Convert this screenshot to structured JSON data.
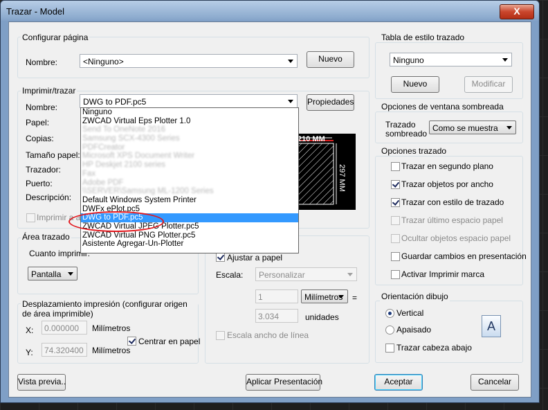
{
  "window": {
    "title": "Trazar - Model",
    "close_glyph": "X"
  },
  "configurar": {
    "group_label": "Configurar página",
    "nombre_label": "Nombre:",
    "nombre_value": "<Ninguno>",
    "nuevo_button": "Nuevo"
  },
  "imprimir": {
    "group_label": "Imprimir/trazar",
    "nombre_label": "Nombre:",
    "nombre_value": "DWG to PDF.pc5",
    "propiedades_button": "Propiedades",
    "papel_label": "Papel:",
    "copias_label": "Copias:",
    "tamano_label": "Tamaño papel:",
    "trazador_label": "Trazador:",
    "puerto_label": "Puerto:",
    "descripcion_label": "Descripción:",
    "imprimir_archivo_label": "Imprimir a ar"
  },
  "dropdown": {
    "items": [
      {
        "label": "Ninguno",
        "state": "normal"
      },
      {
        "label": "ZWCAD Virtual Eps Plotter 1.0",
        "state": "normal"
      },
      {
        "label": "Send To OneNote 2016",
        "state": "blur"
      },
      {
        "label": "Samsung SCX-4300 Series",
        "state": "blur"
      },
      {
        "label": "PDFCreator",
        "state": "blur"
      },
      {
        "label": "Microsoft XPS Document Writer",
        "state": "blur"
      },
      {
        "label": "HP Deskjet 2100 series",
        "state": "blur"
      },
      {
        "label": "Fax",
        "state": "blur"
      },
      {
        "label": "Adobe PDF",
        "state": "blur"
      },
      {
        "label": "\\\\SERVER\\Samsung ML-1200 Series",
        "state": "blur"
      },
      {
        "label": "Default Windows System Printer",
        "state": "normal"
      },
      {
        "label": "DWFx ePlot.pc5",
        "state": "normal"
      },
      {
        "label": "DWG to PDF.pc5",
        "state": "selected"
      },
      {
        "label": "ZWCAD Virtual JPEG Plotter.pc5",
        "state": "normal"
      },
      {
        "label": "ZWCAD Virtual PNG Plotter.pc5",
        "state": "normal"
      },
      {
        "label": "Asistente Agregar-Un-Plotter",
        "state": "normal"
      }
    ]
  },
  "preview": {
    "width_label": "210 MM",
    "height_label": "297 MM"
  },
  "area": {
    "group_label": "Área trazado",
    "cuanto_label": "Cuanto imprimir:",
    "pantalla_value": "Pantalla"
  },
  "escala": {
    "ajustar_label": "Ajustar a papel",
    "escala_label": "Escala:",
    "escala_value": "Personalizar",
    "valor1": "1",
    "unidad_value": "Milímetros",
    "equals": "=",
    "valor2": "3.034",
    "unidades_label": "unidades",
    "escala_ancho_label": "Escala ancho de línea"
  },
  "desplazamiento": {
    "group_label": "Desplazamiento impresión (configurar origen de área imprimible)",
    "x_label": "X:",
    "x_value": "0.000000",
    "x_unit": "Milímetros",
    "centrar_label": "Centrar en papel",
    "y_label": "Y:",
    "y_value": "74.320400",
    "y_unit": "Milímetros"
  },
  "tabla": {
    "group_label": "Tabla de estilo trazado",
    "estilo_value": "Ninguno",
    "nuevo_button": "Nuevo",
    "modificar_button": "Modificar"
  },
  "sombreada": {
    "group_label": "Opciones de ventana sombreada",
    "trazado_label": "Trazado sombreado",
    "trazado_value": "Como se muestra"
  },
  "opciones": {
    "group_label": "Opciones trazado",
    "items": [
      {
        "label": "Trazar en segundo plano",
        "checked": false,
        "disabled": false
      },
      {
        "label": "Trazar objetos por ancho",
        "checked": true,
        "disabled": false
      },
      {
        "label": "Trazar con estilo de trazado",
        "checked": true,
        "disabled": false
      },
      {
        "label": "Trazar último espacio papel",
        "checked": false,
        "disabled": true
      },
      {
        "label": "Ocultar objetos espacio papel",
        "checked": false,
        "disabled": true
      },
      {
        "label": "Guardar cambios en presentación",
        "checked": false,
        "disabled": false
      },
      {
        "label": "Activar Imprimir marca",
        "checked": false,
        "disabled": false
      }
    ]
  },
  "orientacion": {
    "group_label": "Orientación dibujo",
    "vertical_label": "Vertical",
    "apaisado_label": "Apaisado",
    "cabeza_label": "Trazar cabeza abajo",
    "selected": "Vertical",
    "icon_letter": "A"
  },
  "footer": {
    "vista_previa": "Vista previa..",
    "aplicar": "Aplicar Presentación",
    "aceptar": "Aceptar",
    "cancelar": "Cancelar"
  }
}
